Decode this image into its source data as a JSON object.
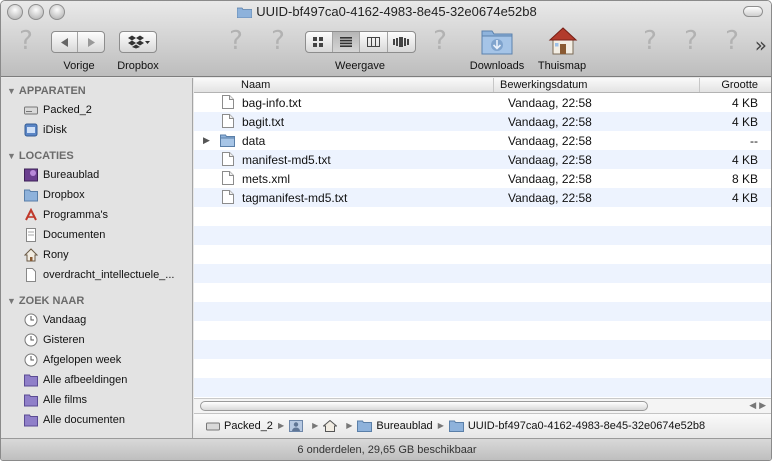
{
  "window": {
    "title": "UUID-bf497ca0-4162-4983-8e45-32e0674e52b8"
  },
  "toolbar": {
    "back_label": "Vorige",
    "dropbox_label": "Dropbox",
    "view_label": "Weergave",
    "downloads_label": "Downloads",
    "home_label": "Thuismap",
    "overflow_glyph": "»",
    "missing_icon_glyph": "?"
  },
  "sidebar": {
    "sections": [
      {
        "title": "APPARATEN",
        "items": [
          {
            "label": "Packed_2",
            "icon": "disk-icon"
          },
          {
            "label": "iDisk",
            "icon": "idisk-icon"
          }
        ]
      },
      {
        "title": "LOCATIES",
        "items": [
          {
            "label": "Bureaublad",
            "icon": "desktop-icon"
          },
          {
            "label": "Dropbox",
            "icon": "folder-icon"
          },
          {
            "label": "Programma's",
            "icon": "applications-icon"
          },
          {
            "label": "Documenten",
            "icon": "documents-icon"
          },
          {
            "label": "Rony",
            "icon": "home-icon"
          },
          {
            "label": "overdracht_intellectuele_...",
            "icon": "document-icon"
          }
        ]
      },
      {
        "title": "ZOEK NAAR",
        "items": [
          {
            "label": "Vandaag",
            "icon": "clock-icon"
          },
          {
            "label": "Gisteren",
            "icon": "clock-icon"
          },
          {
            "label": "Afgelopen week",
            "icon": "clock-icon"
          },
          {
            "label": "Alle afbeeldingen",
            "icon": "smart-folder-icon"
          },
          {
            "label": "Alle films",
            "icon": "smart-folder-icon"
          },
          {
            "label": "Alle documenten",
            "icon": "smart-folder-icon"
          }
        ]
      }
    ]
  },
  "list": {
    "columns": {
      "name": "Naam",
      "date": "Bewerkingsdatum",
      "size": "Grootte"
    },
    "rows": [
      {
        "name": "bag-info.txt",
        "date": "Vandaag, 22:58",
        "size": "4 KB",
        "kind": "file"
      },
      {
        "name": "bagit.txt",
        "date": "Vandaag, 22:58",
        "size": "4 KB",
        "kind": "file"
      },
      {
        "name": "data",
        "date": "Vandaag, 22:58",
        "size": "--",
        "kind": "folder"
      },
      {
        "name": "manifest-md5.txt",
        "date": "Vandaag, 22:58",
        "size": "4 KB",
        "kind": "file"
      },
      {
        "name": "mets.xml",
        "date": "Vandaag, 22:58",
        "size": "8 KB",
        "kind": "file"
      },
      {
        "name": "tagmanifest-md5.txt",
        "date": "Vandaag, 22:58",
        "size": "4 KB",
        "kind": "file"
      }
    ]
  },
  "pathbar": {
    "items": [
      {
        "label": "Packed_2",
        "icon": "disk-icon"
      },
      {
        "label": "",
        "icon": "user-icon"
      },
      {
        "label": "",
        "icon": "home-icon"
      },
      {
        "label": "Bureaublad",
        "icon": "folder-icon"
      },
      {
        "label": "UUID-bf497ca0-4162-4983-8e45-32e0674e52b8",
        "icon": "folder-icon"
      }
    ],
    "separator": "▶"
  },
  "status": {
    "text": "6 onderdelen, 29,65 GB beschikbaar"
  },
  "colors": {
    "folder": "#7fa7d4",
    "row_stripe": "#edf3fe",
    "sidebar_bg": "#e3e3e3"
  }
}
